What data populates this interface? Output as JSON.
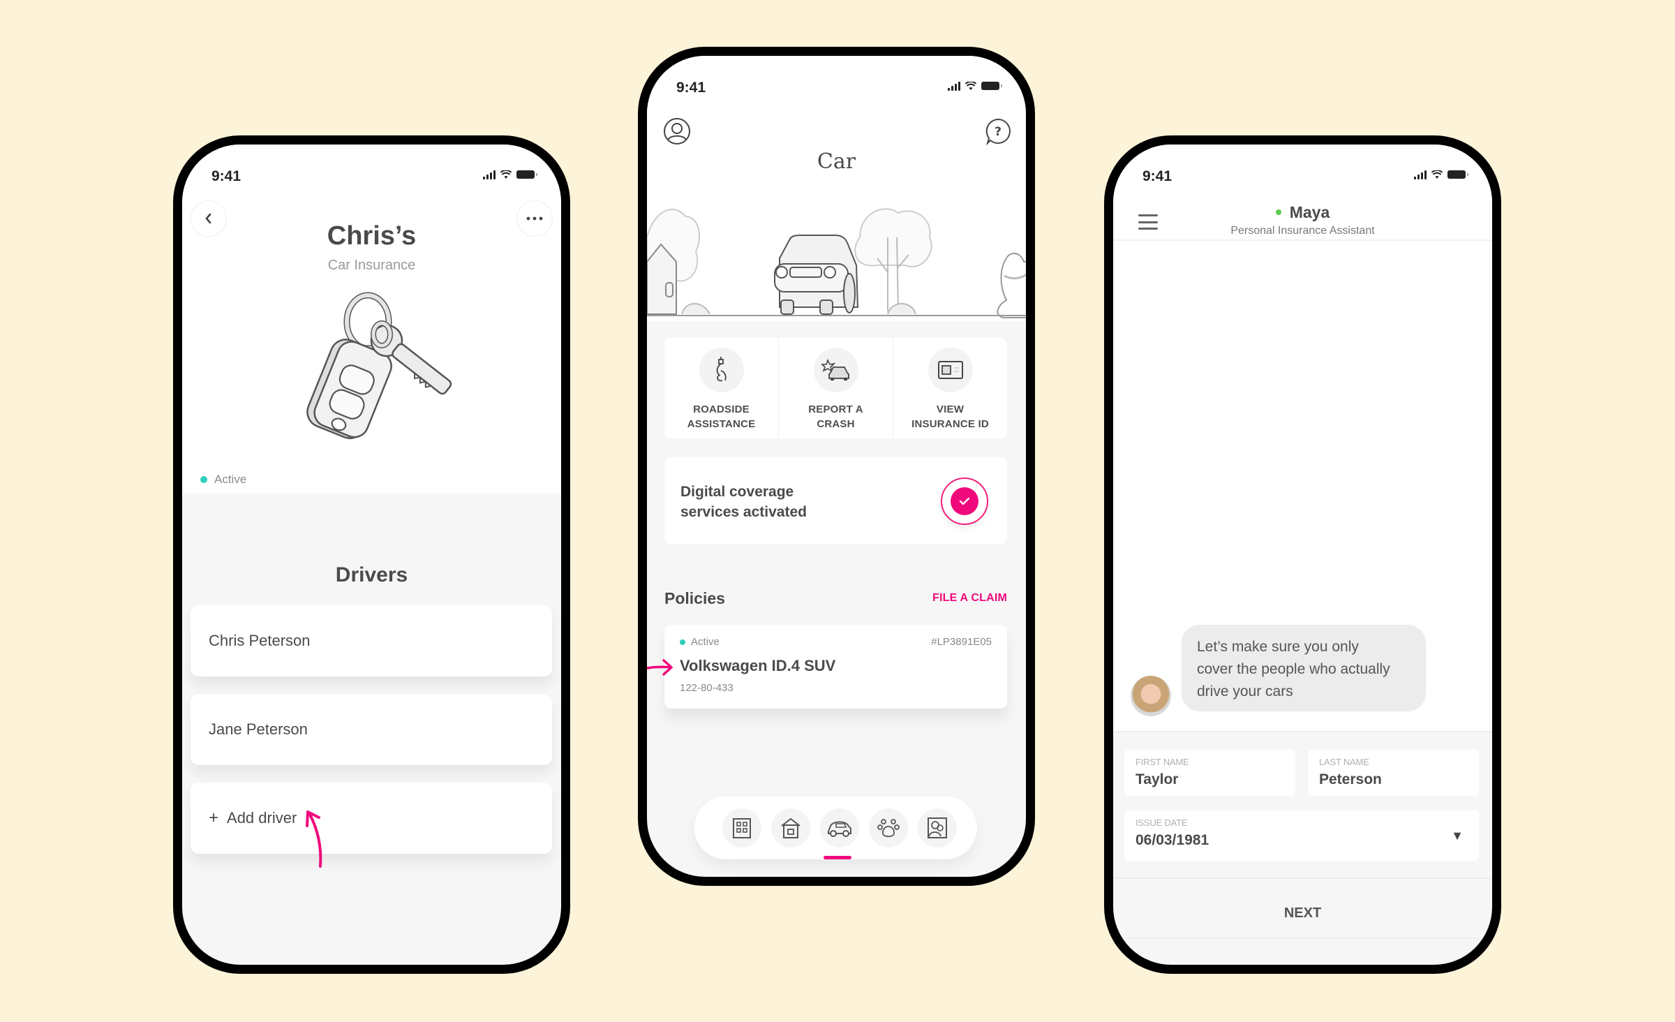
{
  "status_bar": {
    "time": "9:41"
  },
  "colors": {
    "background": "#fdf3d9",
    "accent": "#f0097c",
    "active": "#2dcfb8",
    "online": "#5dcc4f"
  },
  "left_phone": {
    "back_icon": "chevron-left-icon",
    "more_icon": "more-horizontal-icon",
    "title": "Chris’s",
    "subtitle": "Car Insurance",
    "illustration": "car-keys",
    "status": "Active",
    "drivers_title": "Drivers",
    "drivers": [
      {
        "name": "Chris Peterson"
      },
      {
        "name": "Jane Peterson"
      }
    ],
    "add_driver_icon": "+",
    "add_driver_label": "Add driver"
  },
  "middle_phone": {
    "profile_icon": "user-circle-icon",
    "help_icon": "help-bubble-icon",
    "title": "Car",
    "illustration": "house-car-tree-dog",
    "actions": [
      {
        "icon": "tow-hook-icon",
        "line1": "ROADSIDE",
        "line2": "ASSISTANCE"
      },
      {
        "icon": "car-crash-icon",
        "line1": "REPORT A",
        "line2": "CRASH"
      },
      {
        "icon": "id-card-icon",
        "line1": "VIEW",
        "line2": "INSURANCE ID"
      }
    ],
    "coverage": {
      "line1": "Digital coverage",
      "line2": "services activated",
      "checked": true
    },
    "policies_label": "Policies",
    "file_claim_label": "FILE A CLAIM",
    "policy": {
      "status": "Active",
      "id": "#LP3891E05",
      "name": "Volkswagen ID.4 SUV",
      "number": "122-80-433"
    },
    "nav": [
      {
        "icon": "building-icon",
        "name": "apartment"
      },
      {
        "icon": "house-icon",
        "name": "home"
      },
      {
        "icon": "car-icon",
        "name": "car",
        "active": true
      },
      {
        "icon": "paw-icon",
        "name": "pet"
      },
      {
        "icon": "people-frame-icon",
        "name": "life"
      }
    ]
  },
  "right_phone": {
    "menu_icon": "hamburger-icon",
    "assistant_name": "Maya",
    "assistant_role": "Personal Insurance Assistant",
    "message": [
      "Let’s make sure you only",
      "cover the people who actually",
      "drive your cars"
    ],
    "form": {
      "first_name_label": "FIRST NAME",
      "first_name_value": "Taylor",
      "last_name_label": "LAST NAME",
      "last_name_value": "Peterson",
      "issue_date_label": "ISSUE DATE",
      "issue_date_value": "06/03/1981",
      "dropdown_icon": "▼"
    },
    "next_label": "NEXT"
  }
}
